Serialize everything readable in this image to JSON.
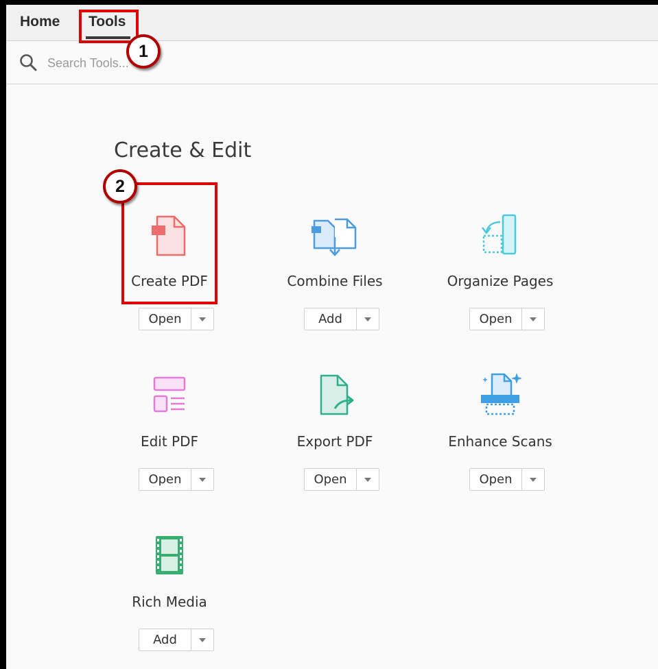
{
  "nav": {
    "tabs": [
      {
        "label": "Home"
      },
      {
        "label": "Tools"
      }
    ],
    "active": "Tools"
  },
  "search": {
    "placeholder": "Search Tools..."
  },
  "section": {
    "title": "Create & Edit"
  },
  "tools": [
    {
      "name": "Create PDF",
      "button": "Open",
      "icon": "create-pdf-icon",
      "color": "#ec6b6b"
    },
    {
      "name": "Combine Files",
      "button": "Add",
      "icon": "combine-files-icon",
      "color": "#4a9be0"
    },
    {
      "name": "Organize Pages",
      "button": "Open",
      "icon": "organize-pages-icon",
      "color": "#4cc9e0"
    },
    {
      "name": "Edit PDF",
      "button": "Open",
      "icon": "edit-pdf-icon",
      "color": "#e27ad6"
    },
    {
      "name": "Export PDF",
      "button": "Open",
      "icon": "export-pdf-icon",
      "color": "#2fae8a"
    },
    {
      "name": "Enhance Scans",
      "button": "Open",
      "icon": "enhance-scans-icon",
      "color": "#3f9fe0"
    },
    {
      "name": "Rich Media",
      "button": "Add",
      "icon": "rich-media-icon",
      "color": "#37ad72"
    }
  ],
  "annotations": {
    "badge1": "1",
    "badge2": "2",
    "highlight_color": "#e00000"
  }
}
